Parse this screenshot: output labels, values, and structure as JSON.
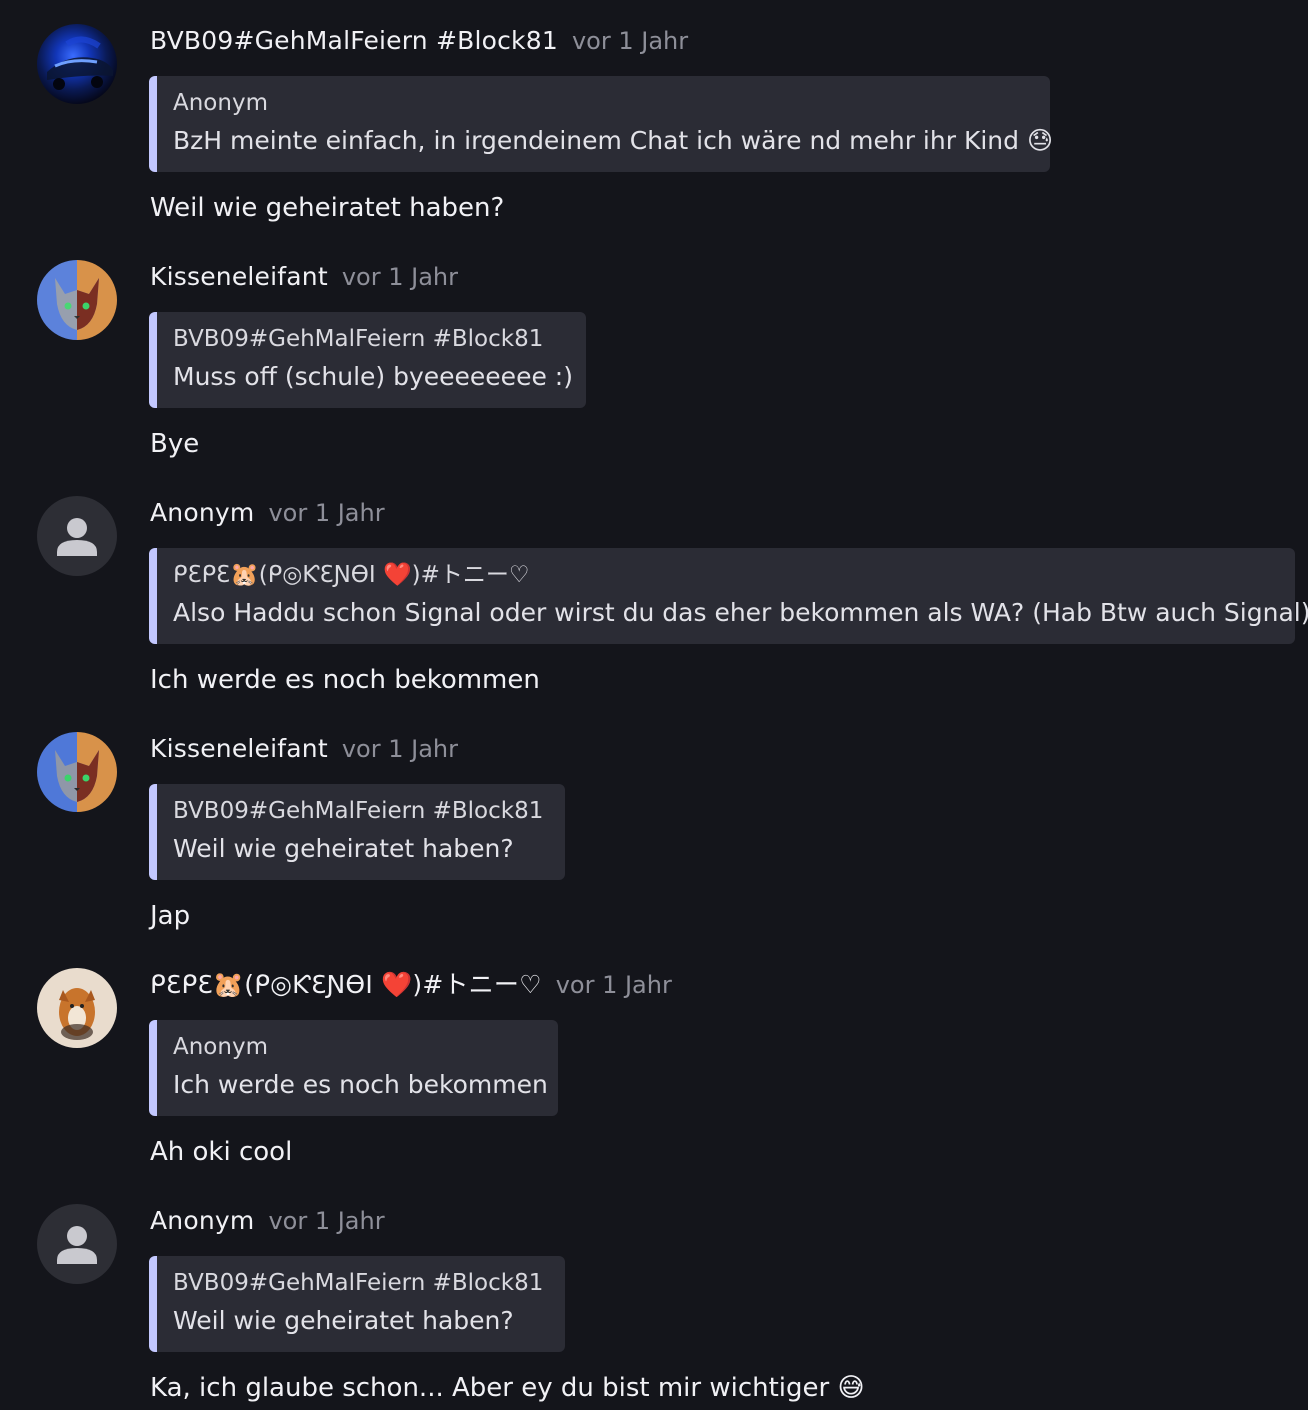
{
  "messages": [
    {
      "author": "BVB09#GehMalFeiern #Block81",
      "time": "vor 1 Jahr",
      "quote": {
        "author": "Anonym",
        "text": "BzH meinte einfach, in irgendeinem Chat ich wäre nd mehr ihr Kind 😓"
      },
      "text": "Weil wie geheiratet haben?",
      "avatar": "blue-car-avatar"
    },
    {
      "author": "Kisseneleifant",
      "time": "vor 1 Jahr",
      "quote": {
        "author": "BVB09#GehMalFeiern #Block81",
        "text": "Muss off (schule) byeeeeeeee :)"
      },
      "text": "Bye",
      "avatar": "cat-split-avatar"
    },
    {
      "author": "Anonym",
      "time": "vor 1 Jahr",
      "quote": {
        "author": "ᑭƐᑭƐ🐹(ᑭ◎ƘƐƝӨӀ ❤️)#トニー♡",
        "text": "Also Haddu schon Signal oder wirst du das eher bekommen als WA? (Hab Btw auch Signal)"
      },
      "text": "Ich werde es noch bekommen",
      "avatar": "person-icon"
    },
    {
      "author": "Kisseneleifant",
      "time": "vor 1 Jahr",
      "quote": {
        "author": "BVB09#GehMalFeiern #Block81",
        "text": "Weil wie geheiratet haben?"
      },
      "text": "Jap",
      "avatar": "cat-split-avatar"
    },
    {
      "author": "ᑭƐᑭƐ🐹(ᑭ◎ƘƐƝӨӀ ❤️)#トニー♡",
      "time": "vor 1 Jahr",
      "quote": {
        "author": "Anonym",
        "text": "Ich werde es noch bekommen"
      },
      "text": "Ah oki cool",
      "avatar": "fox-avatar"
    },
    {
      "author": "Anonym",
      "time": "vor 1 Jahr",
      "quote": {
        "author": "BVB09#GehMalFeiern #Block81",
        "text": "Weil wie geheiratet haben?"
      },
      "text": "Ka, ich glaube schon... Aber ey du bist mir wichtiger 😅",
      "avatar": "person-icon"
    }
  ],
  "colors": {
    "background": "#14151b",
    "quote_background": "#2b2c35",
    "quote_accent": "#c3c8ff",
    "timestamp": "#8e8f99",
    "text": "#f1f1f5"
  }
}
